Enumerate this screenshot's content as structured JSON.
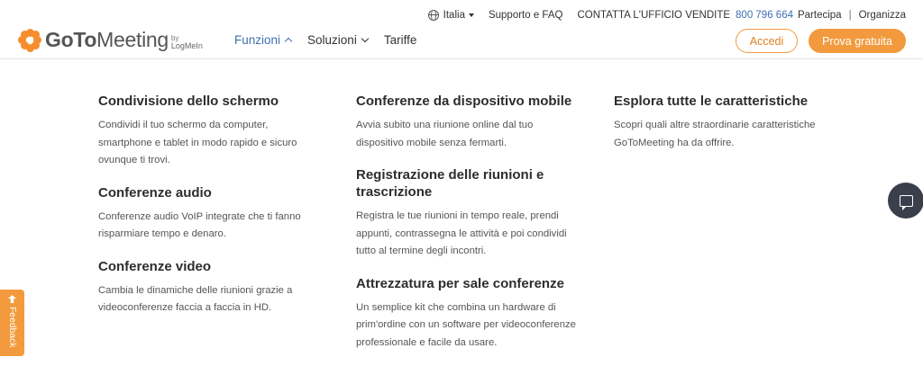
{
  "utility": {
    "language": "Italia",
    "support": "Supporto e FAQ",
    "contact_label": "CONTATTA L'UFFICIO VENDITE",
    "phone": "800 796 664",
    "join": "Partecipa",
    "separator": "|",
    "organize": "Organizza"
  },
  "logo": {
    "bold": "GoTo",
    "regular": "Meeting",
    "by": "by",
    "parent": "LogMeIn"
  },
  "nav": {
    "items": [
      {
        "label": "Funzioni",
        "active": true,
        "caret": "up"
      },
      {
        "label": "Soluzioni",
        "active": false,
        "caret": "down"
      },
      {
        "label": "Tariffe",
        "active": false,
        "caret": null
      }
    ]
  },
  "buttons": {
    "login": "Accedi",
    "trial": "Prova gratuita"
  },
  "colors": {
    "accent_orange": "#f29a3d",
    "link_blue": "#3f6fae",
    "chat_dark": "#3a3f4b"
  },
  "menu": {
    "columns": [
      [
        {
          "title": "Condivisione dello schermo",
          "desc": "Condividi il tuo schermo da computer, smartphone e tablet in modo rapido e sicuro ovunque ti trovi."
        },
        {
          "title": "Conferenze audio",
          "desc": "Conferenze audio VoIP integrate che ti fanno risparmiare tempo e denaro."
        },
        {
          "title": "Conferenze video",
          "desc": "Cambia le dinamiche delle riunioni grazie a videoconferenze faccia a faccia in HD."
        }
      ],
      [
        {
          "title": "Conferenze da dispositivo mobile",
          "desc": "Avvia subito una riunione online dal tuo dispositivo mobile senza fermarti."
        },
        {
          "title": "Registrazione delle riunioni e trascrizione",
          "desc": "Registra le tue riunioni in tempo reale, prendi appunti, contrassegna le attività e poi condividi tutto al termine degli incontri."
        },
        {
          "title": "Attrezzatura per sale conferenze",
          "desc": "Un semplice kit che combina un hardware di prim'ordine con un software per videoconferenze professionale e facile da usare."
        }
      ],
      [
        {
          "title": "Esplora tutte le caratteristiche",
          "desc": "Scopri quali altre straordinarie caratteristiche GoToMeeting ha da offrire."
        }
      ]
    ]
  },
  "feedback": {
    "label": "Feedback",
    "icon": "arrow-up-icon"
  },
  "chat": {
    "icon": "chat-bubble-icon"
  }
}
